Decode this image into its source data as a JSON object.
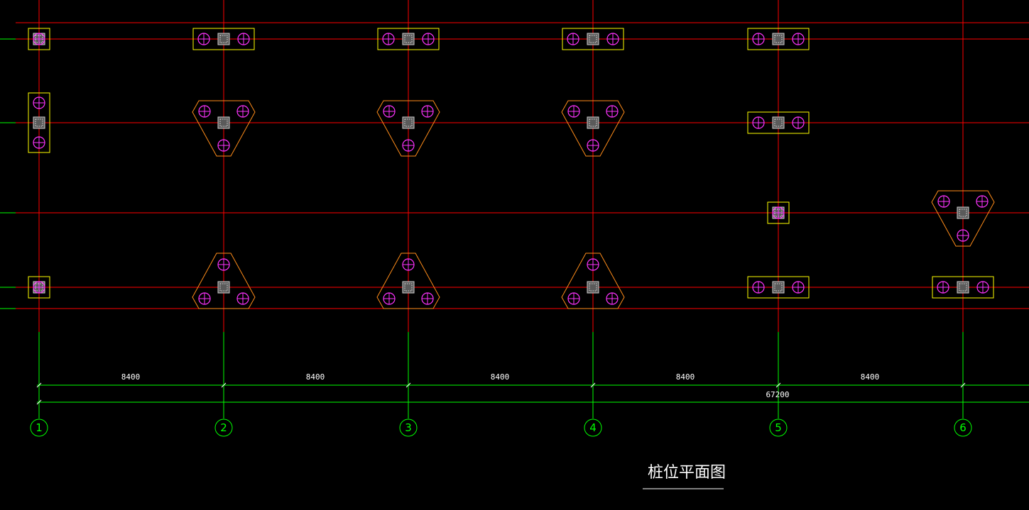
{
  "drawing": {
    "title": "桩位平面图",
    "axes": [
      "1",
      "2",
      "3",
      "4",
      "5",
      "6"
    ],
    "spans": [
      "8400",
      "8400",
      "8400",
      "8400",
      "8400"
    ],
    "total_dimension": "67200",
    "pile_caps": [
      {
        "axis": "1",
        "row": 1,
        "type": "single"
      },
      {
        "axis": "2",
        "row": 1,
        "type": "double-horizontal"
      },
      {
        "axis": "3",
        "row": 1,
        "type": "double-horizontal"
      },
      {
        "axis": "4",
        "row": 1,
        "type": "double-horizontal"
      },
      {
        "axis": "5",
        "row": 1,
        "type": "double-horizontal"
      },
      {
        "axis": "1",
        "row": 2,
        "type": "double-vertical"
      },
      {
        "axis": "2",
        "row": 2,
        "type": "triangle-down"
      },
      {
        "axis": "3",
        "row": 2,
        "type": "triangle-down"
      },
      {
        "axis": "4",
        "row": 2,
        "type": "triangle-down"
      },
      {
        "axis": "5",
        "row": 2,
        "type": "double-horizontal"
      },
      {
        "axis": "5",
        "row": 3,
        "type": "single"
      },
      {
        "axis": "6",
        "row": 3,
        "type": "triangle-down"
      },
      {
        "axis": "1",
        "row": 4,
        "type": "single"
      },
      {
        "axis": "2",
        "row": 4,
        "type": "triangle-up"
      },
      {
        "axis": "3",
        "row": 4,
        "type": "triangle-up"
      },
      {
        "axis": "4",
        "row": 4,
        "type": "triangle-up"
      },
      {
        "axis": "5",
        "row": 4,
        "type": "double-horizontal"
      },
      {
        "axis": "6",
        "row": 4,
        "type": "double-horizontal"
      }
    ],
    "colors": {
      "background": "#000000",
      "grid_line": "#ff0000",
      "cap_rect": "#ffff00",
      "cap_triangle": "#ff8c1a",
      "pile": "#ff33ff",
      "dimension": "#00ff00",
      "text": "#ffffff"
    }
  }
}
